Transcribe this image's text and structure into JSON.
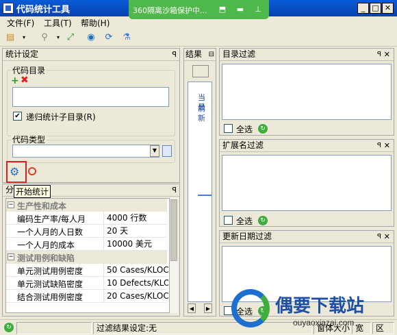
{
  "window": {
    "title": "代码统计工具"
  },
  "float360": {
    "text": "360隔离沙箱保护中..."
  },
  "menu": {
    "items": [
      "文件(F)",
      "工具(T)",
      "帮助(H)"
    ]
  },
  "stats_settings": {
    "header": "统计设定",
    "code_dir_label": "代码目录",
    "recursive_label": "递归统计子目录(R)",
    "code_type_label": "代码类型",
    "start_tooltip": "开始统计"
  },
  "results": {
    "header": "结果",
    "text_lines": [
      "当前",
      "最新"
    ]
  },
  "stats_table": {
    "header_prefix": "分",
    "categories": [
      {
        "name": "生产性和成本",
        "rows": [
          {
            "key": "编码生产率/每人月",
            "value": "4000 行数"
          },
          {
            "key": "一个人月的人日数",
            "value": "20 天"
          },
          {
            "key": "一个人月的成本",
            "value": "10000 美元"
          }
        ]
      },
      {
        "name": "测试用例和缺陷",
        "rows": [
          {
            "key": "单元测试用例密度",
            "value": "50 Cases/KLOC"
          },
          {
            "key": "单元测试缺陷密度",
            "value": "10 Defects/KLOC"
          },
          {
            "key": "结合测试用例密度",
            "value": "20 Cases/KLOC"
          }
        ]
      }
    ]
  },
  "dir_filter": {
    "header": "目录过滤",
    "select_all": "全选"
  },
  "ext_filter": {
    "header": "扩展名过滤",
    "select_all": "全选"
  },
  "date_filter": {
    "header": "更新日期过滤",
    "select_all": "全选"
  },
  "statusbar": {
    "filter_result": "过滤结果设定:无",
    "cell_a": "窗体大小",
    "cell_b": "宽",
    "cell_c": "区"
  },
  "watermark": {
    "brand": "偶要下载站",
    "url": "ouyaoxiazai.com"
  },
  "colors": {
    "title_blue": "#0842b0",
    "accent_green": "#3fae3f",
    "highlight_red": "#e02020"
  }
}
